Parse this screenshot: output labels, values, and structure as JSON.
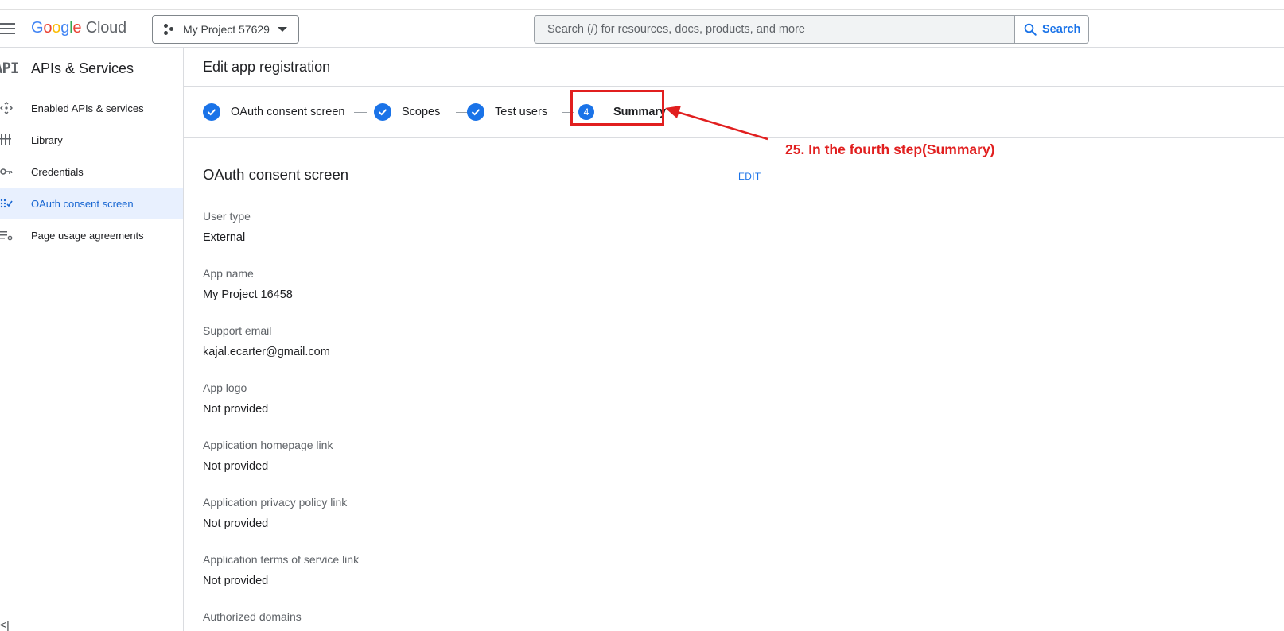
{
  "header": {
    "logo": {
      "g1": "G",
      "g2": "o",
      "g3": "o",
      "g4": "g",
      "g5": "l",
      "g6": "e",
      "cloud": "Cloud"
    },
    "project_label": "My Project 57629",
    "search_placeholder": "Search (/) for resources, docs, products, and more",
    "search_button": "Search"
  },
  "sidebar": {
    "icon_text": "API",
    "title": "APIs & Services",
    "items": [
      {
        "label": "Enabled APIs & services",
        "icon": "enabled-apis-icon",
        "active": false
      },
      {
        "label": "Library",
        "icon": "library-icon",
        "active": false
      },
      {
        "label": "Credentials",
        "icon": "key-icon",
        "active": false
      },
      {
        "label": "OAuth consent screen",
        "icon": "oauth-consent-icon",
        "active": true
      },
      {
        "label": "Page usage agreements",
        "icon": "page-usage-icon",
        "active": false
      }
    ],
    "collapse_glyph": "<|"
  },
  "main": {
    "page_title": "Edit app registration",
    "steps": [
      {
        "label": "OAuth consent screen",
        "state": "done"
      },
      {
        "label": "Scopes",
        "state": "done"
      },
      {
        "label": "Test users",
        "state": "done"
      },
      {
        "label": "Summary",
        "state": "current",
        "number": "4"
      }
    ],
    "section_title": "OAuth consent screen",
    "edit_label": "EDIT",
    "fields": [
      {
        "label": "User type",
        "value": "External"
      },
      {
        "label": "App name",
        "value": "My Project 16458"
      },
      {
        "label": "Support email",
        "value": "kajal.ecarter@gmail.com"
      },
      {
        "label": "App logo",
        "value": "Not provided"
      },
      {
        "label": "Application homepage link",
        "value": "Not provided"
      },
      {
        "label": "Application privacy policy link",
        "value": "Not provided"
      },
      {
        "label": "Application terms of service link",
        "value": "Not provided"
      },
      {
        "label": "Authorized domains",
        "value": ""
      }
    ]
  },
  "annotation": {
    "text": "25. In the fourth step(Summary)",
    "color": "#e11f1f"
  },
  "colors": {
    "accent": "#1a73e8",
    "active_bg": "#e8f0fe",
    "annotation_red": "#e11f1f"
  }
}
